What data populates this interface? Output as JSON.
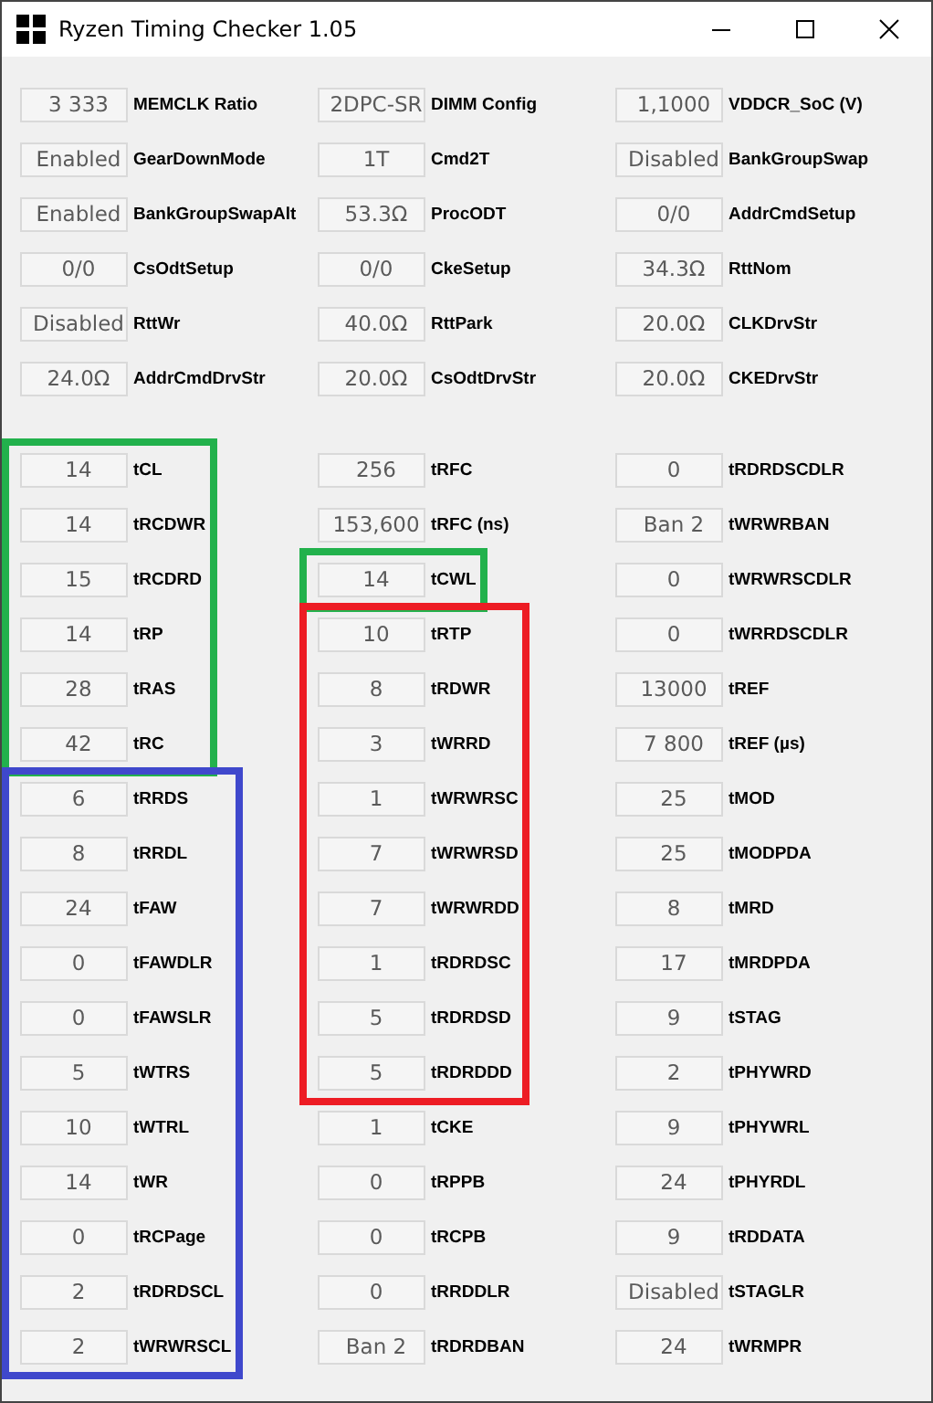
{
  "window": {
    "title": "Ryzen Timing Checker 1.05"
  },
  "settings": [
    {
      "value": "3 333",
      "label": "MEMCLK Ratio"
    },
    {
      "value": "2DPC-SR",
      "label": "DIMM Config"
    },
    {
      "value": "1,1000",
      "label": "VDDCR_SoC (V)"
    },
    {
      "value": "Enabled",
      "label": "GearDownMode"
    },
    {
      "value": "1T",
      "label": "Cmd2T"
    },
    {
      "value": "Disabled",
      "label": "BankGroupSwap"
    },
    {
      "value": "Enabled",
      "label": "BankGroupSwapAlt"
    },
    {
      "value": "53.3Ω",
      "label": "ProcODT"
    },
    {
      "value": "0/0",
      "label": "AddrCmdSetup"
    },
    {
      "value": "0/0",
      "label": "CsOdtSetup"
    },
    {
      "value": "0/0",
      "label": "CkeSetup"
    },
    {
      "value": "34.3Ω",
      "label": "RttNom"
    },
    {
      "value": "Disabled",
      "label": "RttWr"
    },
    {
      "value": "40.0Ω",
      "label": "RttPark"
    },
    {
      "value": "20.0Ω",
      "label": "CLKDrvStr"
    },
    {
      "value": "24.0Ω",
      "label": "AddrCmdDrvStr"
    },
    {
      "value": "20.0Ω",
      "label": "CsOdtDrvStr"
    },
    {
      "value": "20.0Ω",
      "label": "CKEDrvStr"
    }
  ],
  "timings": [
    {
      "value": "14",
      "label": "tCL",
      "color": "#22b14c"
    },
    {
      "value": "256",
      "label": "tRFC"
    },
    {
      "value": "0",
      "label": "tRDRDSCDLR"
    },
    {
      "value": "14",
      "label": "tRCDWR",
      "color": "#22b14c"
    },
    {
      "value": "153,600",
      "label": "tRFC (ns)"
    },
    {
      "value": "Ban 2",
      "label": "tWRWRBAN"
    },
    {
      "value": "15",
      "label": "tRCDRD",
      "color": "#22b14c"
    },
    {
      "value": "14",
      "label": "tCWL",
      "color": "#22b14c"
    },
    {
      "value": "0",
      "label": "tWRWRSCDLR"
    },
    {
      "value": "14",
      "label": "tRP",
      "color": "#22b14c"
    },
    {
      "value": "10",
      "label": "tRTP",
      "color": "#ed1c24"
    },
    {
      "value": "0",
      "label": "tWRRDSCDLR"
    },
    {
      "value": "28",
      "label": "tRAS",
      "color": "#22b14c"
    },
    {
      "value": "8",
      "label": "tRDWR",
      "color": "#ed1c24"
    },
    {
      "value": "13000",
      "label": "tREF"
    },
    {
      "value": "42",
      "label": "tRC",
      "color": "#22b14c"
    },
    {
      "value": "3",
      "label": "tWRRD",
      "color": "#ed1c24"
    },
    {
      "value": "7 800",
      "label": "tREF (µs)"
    },
    {
      "value": "6",
      "label": "tRRDS",
      "color": "#3f48cc"
    },
    {
      "value": "1",
      "label": "tWRWRSC",
      "color": "#ed1c24"
    },
    {
      "value": "25",
      "label": "tMOD"
    },
    {
      "value": "8",
      "label": "tRRDL",
      "color": "#3f48cc"
    },
    {
      "value": "7",
      "label": "tWRWRSD",
      "color": "#ed1c24"
    },
    {
      "value": "25",
      "label": "tMODPDA"
    },
    {
      "value": "24",
      "label": "tFAW",
      "color": "#3f48cc"
    },
    {
      "value": "7",
      "label": "tWRWRDD",
      "color": "#ed1c24"
    },
    {
      "value": "8",
      "label": "tMRD"
    },
    {
      "value": "0",
      "label": "tFAWDLR",
      "color": "#3f48cc"
    },
    {
      "value": "1",
      "label": "tRDRDSC",
      "color": "#ed1c24"
    },
    {
      "value": "17",
      "label": "tMRDPDA"
    },
    {
      "value": "0",
      "label": "tFAWSLR",
      "color": "#3f48cc"
    },
    {
      "value": "5",
      "label": "tRDRDSD",
      "color": "#ed1c24"
    },
    {
      "value": "9",
      "label": "tSTAG"
    },
    {
      "value": "5",
      "label": "tWTRS",
      "color": "#3f48cc"
    },
    {
      "value": "5",
      "label": "tRDRDDD",
      "color": "#ed1c24"
    },
    {
      "value": "2",
      "label": "tPHYWRD"
    },
    {
      "value": "10",
      "label": "tWTRL",
      "color": "#3f48cc"
    },
    {
      "value": "1",
      "label": "tCKE"
    },
    {
      "value": "9",
      "label": "tPHYWRL"
    },
    {
      "value": "14",
      "label": "tWR",
      "color": "#3f48cc"
    },
    {
      "value": "0",
      "label": "tRPPB"
    },
    {
      "value": "24",
      "label": "tPHYRDL"
    },
    {
      "value": "0",
      "label": "tRCPage",
      "color": "#3f48cc"
    },
    {
      "value": "0",
      "label": "tRCPB"
    },
    {
      "value": "9",
      "label": "tRDDATA"
    },
    {
      "value": "2",
      "label": "tRDRDSCL",
      "color": "#3f48cc"
    },
    {
      "value": "0",
      "label": "tRRDDLR"
    },
    {
      "value": "Disabled",
      "label": "tSTAGLR"
    },
    {
      "value": "2",
      "label": "tWRWRSCL",
      "color": "#3f48cc"
    },
    {
      "value": "Ban 2",
      "label": "tRDRDBAN"
    },
    {
      "value": "24",
      "label": "tWRMPR"
    }
  ]
}
